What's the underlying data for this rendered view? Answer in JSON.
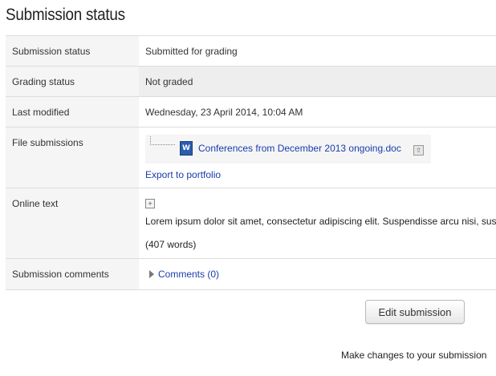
{
  "page": {
    "title": "Submission status"
  },
  "rows": {
    "submission_status": {
      "label": "Submission status",
      "value": "Submitted for grading"
    },
    "grading_status": {
      "label": "Grading status",
      "value": "Not graded"
    },
    "last_modified": {
      "label": "Last modified",
      "value": "Wednesday, 23 April 2014, 10:04 AM"
    },
    "file_submissions": {
      "label": "File submissions",
      "file_icon": "word-document-icon",
      "file_icon_glyph": "W",
      "file_name": "Conferences from December 2013 ongoing.doc",
      "portfolio_icon": "portfolio-export-icon",
      "export_link": "Export to portfolio"
    },
    "online_text": {
      "label": "Online text",
      "expand_icon": "expand-icon",
      "expand_glyph": "+",
      "text": "Lorem ipsum dolor sit amet, consectetur adipiscing elit. Suspendisse arcu nisi, suscipit",
      "word_count": "(407 words)"
    },
    "submission_comments": {
      "label": "Submission comments",
      "link": "Comments (0)"
    }
  },
  "actions": {
    "edit_button": "Edit submission",
    "help_text": "Make changes to your submission"
  },
  "colors": {
    "link": "#1a3cad",
    "label_background": "#f5f5f5",
    "highlight_background": "#eeeeee",
    "border": "#dddddd"
  }
}
